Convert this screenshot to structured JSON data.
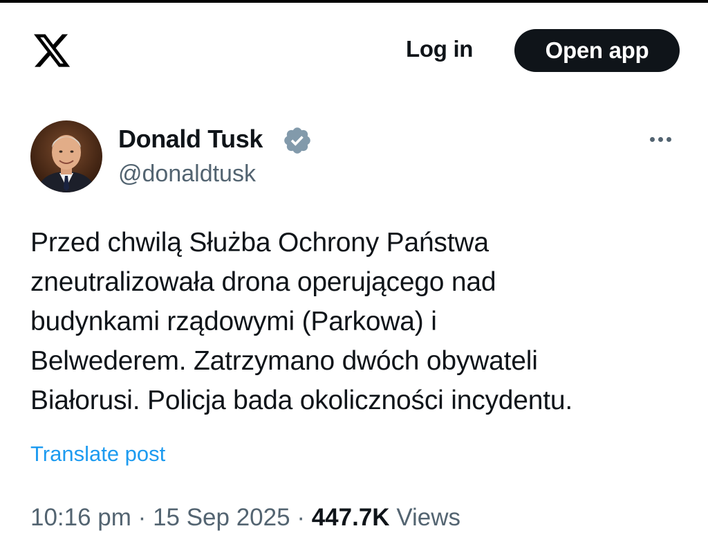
{
  "header": {
    "logo_icon": "x-logo-icon",
    "login_label": "Log in",
    "open_app_label": "Open app"
  },
  "author": {
    "display_name": "Donald Tusk",
    "handle": "@donaldtusk",
    "verified_icon": "verified-badge-icon",
    "verified_color": "#829aab",
    "more_icon": "more-horizontal-icon"
  },
  "tweet": {
    "lines": [
      "Przed chwilą Służba Ochrony Państwa",
      "zneutralizowała drona operującego nad",
      "budynkami rządowymi (Parkowa) i",
      "Belwederem. Zatrzymano dwóch obywateli",
      "Białorusi. Policja bada okoliczności incydentu."
    ],
    "translate_label": "Translate post"
  },
  "meta": {
    "time": "10:16 pm",
    "separator": "·",
    "date": "15 Sep 2025",
    "views_count": "447.7K",
    "views_label": "Views"
  },
  "colors": {
    "text": "#0f1419",
    "secondary": "#536471",
    "link": "#1d9bf0",
    "button_bg": "#0f1419"
  }
}
